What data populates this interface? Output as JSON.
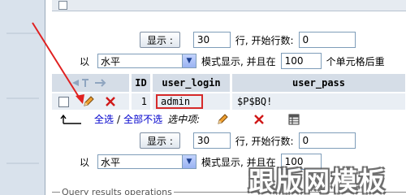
{
  "paging": {
    "show_button": "显示 :",
    "row_count": "30",
    "rows_start_label": "行, 开始行数:",
    "start_row": "0",
    "mode_prefix": "以",
    "mode_value": "水平",
    "mode_suffix": "模式显示, 并且在",
    "repeat_count": "100",
    "repeat_suffix": "个单元格后重"
  },
  "table": {
    "headers": {
      "id": "ID",
      "login": "user_login",
      "pass": "user_pass"
    },
    "rows": [
      {
        "id": "1",
        "login": "admin",
        "pass": "$P$BQ!"
      }
    ]
  },
  "bulk": {
    "check_all": "全选",
    "separator": "/",
    "uncheck_all": "全部不选",
    "selected_label": "选中项:"
  },
  "bottom_legend": "Query results operations",
  "watermark": "跟版网模板",
  "colors": {
    "arrow": "#e02020",
    "highlight_box": "#d62a2a",
    "link": "#0000cc",
    "header_bg": "#d5dde7",
    "row_bg": "#e9eef4"
  }
}
